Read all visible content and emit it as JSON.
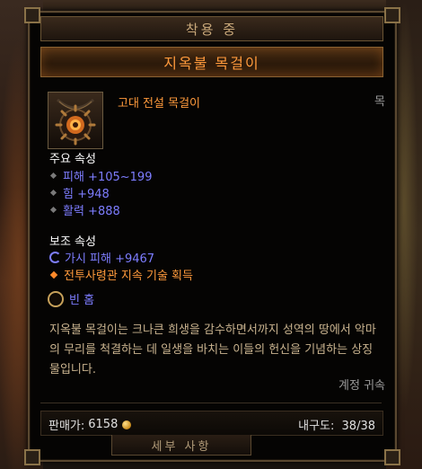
{
  "header": {
    "equipped_label": "착용 중",
    "item_name": "지옥불 목걸이"
  },
  "item": {
    "icon": "amulet-icon",
    "type": "고대 전설 목걸이",
    "slot": "목"
  },
  "primary": {
    "title": "주요 속성",
    "stats": [
      "피해 +105~199",
      "힘 +948",
      "활력 +888"
    ]
  },
  "secondary": {
    "title": "보조 속성",
    "stats": [
      "가시 피해 +9467",
      "전투사령관 지속 기술 획득"
    ]
  },
  "socket": {
    "label": "빈 홈"
  },
  "flavor": {
    "text": "지옥불 목걸이는 크나큰 희생을 감수하면서까지 성역의 땅에서 악마의 무리를 척결하는 데 일생을 바치는 이들의 헌신을 기념하는 상징물입니다."
  },
  "binding": "계정 귀속",
  "footer": {
    "sell_label": "판매가:",
    "sell_value": "6158",
    "durability_label": "내구도:",
    "durability_value": "38/38"
  },
  "details_tab": "세부 사항",
  "colors": {
    "legendary": "#ff9a3c",
    "magic_stat": "#7d7dff",
    "flavor": "#c9b38f",
    "socket_ring": "#c7a15a"
  }
}
